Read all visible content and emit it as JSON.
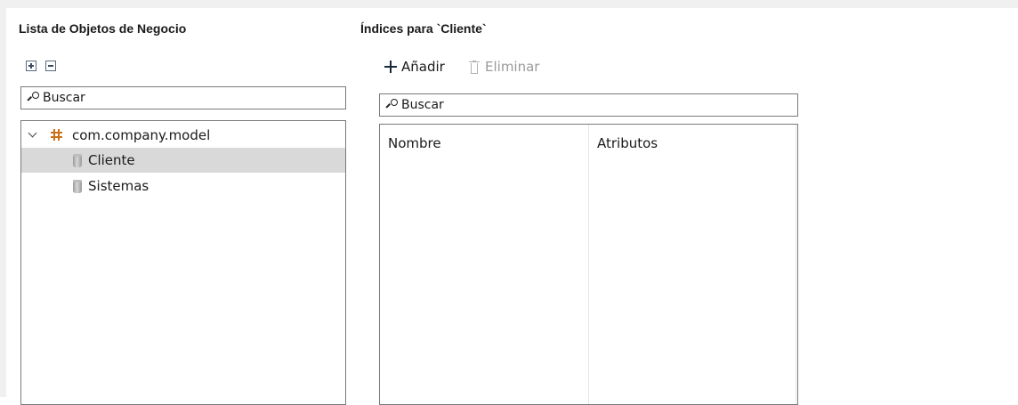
{
  "left_panel": {
    "title": "Lista de Objetos de Negocio",
    "search": {
      "placeholder": "Buscar",
      "value": ""
    },
    "tree": {
      "package": {
        "label": "com.company.model",
        "icon": "package-icon",
        "expanded": true
      },
      "items": [
        {
          "label": "Cliente",
          "icon": "entity-icon",
          "selected": true
        },
        {
          "label": "Sistemas",
          "icon": "entity-icon",
          "selected": false
        }
      ]
    }
  },
  "right_panel": {
    "title": "Índices para `Cliente`",
    "toolbar": {
      "add_label": "Añadir",
      "delete_label": "Eliminar"
    },
    "search": {
      "placeholder": "Buscar",
      "value": ""
    },
    "table": {
      "columns": [
        "Nombre",
        "Atributos"
      ],
      "rows": []
    }
  },
  "colors": {
    "selection": "#d9d9d9",
    "package_icon": "#c9711a",
    "disabled_text": "#9a9a9a",
    "border": "#7a7a7a"
  }
}
